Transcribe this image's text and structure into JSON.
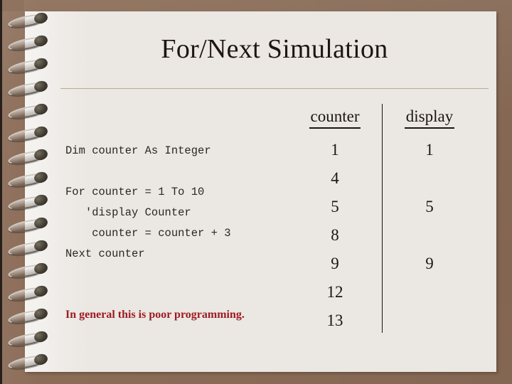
{
  "slide": {
    "title": "For/Next Simulation",
    "theme": {
      "background": "#8c6d58",
      "page": "#ebe7e2",
      "title_color": "#1d1510",
      "rule_color": "#b9ab8d",
      "code_color": "#2b2723",
      "note_color": "#9d1b24",
      "divider_color": "#181410"
    }
  },
  "code": {
    "lines": [
      "Dim counter As Integer",
      "",
      "For counter = 1 To 10",
      "   'display Counter",
      "    counter = counter + 3",
      "Next counter"
    ]
  },
  "note": {
    "text": "In general this is poor programming."
  },
  "trace": {
    "columns": [
      {
        "header": "counter",
        "values": [
          "1",
          "4",
          "5",
          "8",
          "9",
          "12",
          "13"
        ]
      },
      {
        "header": "display",
        "values": [
          "1",
          "",
          "5",
          "",
          "9",
          "",
          ""
        ]
      }
    ]
  },
  "binding": {
    "icon": "spiral-coil-icon",
    "ring_count": 16
  }
}
